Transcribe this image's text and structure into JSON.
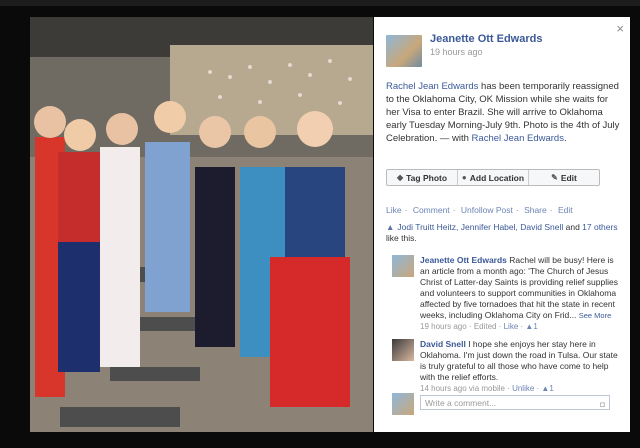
{
  "post": {
    "author": "Jeanette Ott Edwards",
    "time": "19 hours ago",
    "caption_link": "Rachel Jean Edwards",
    "caption_text": " has been temporarily reassigned to the Oklahoma City, OK Mission while she waits for her Visa to enter Brazil. She will arrive to Oklahoma early Tuesday Morning-July 9th. Photo is the 4th of July Celebration. — with ",
    "with_link": "Rachel Jean Edwards",
    "with_end": "."
  },
  "buttons": {
    "tag": "Tag Photo",
    "location": "Add Location",
    "edit": "Edit"
  },
  "actions": {
    "like": "Like",
    "sep": "·",
    "comment": "Comment",
    "unfollow": "Unfollow Post",
    "share": "Share",
    "edit": "Edit"
  },
  "likes": {
    "names": "Jodi Truitt Heitz, Jennifer Habel, David Snell",
    "and": " and ",
    "others": "17 others",
    "end": " like this."
  },
  "comments": [
    {
      "name": "Jeanette Ott Edwards",
      "text": " Rachel will be busy! Here is an article from a month ago: 'The Church of Jesus Christ of Latter-day Saints is providing relief supplies and volunteers to support communities in Oklahoma affected by five tornadoes that hit the state in recent weeks, including Oklahoma City on Frid...",
      "see_more": "See More",
      "time": "19 hours ago",
      "edited": "Edited",
      "like": "Like",
      "count": "1"
    },
    {
      "name": "David Snell",
      "text": " I hope she enjoys her stay here in Oklahoma. I'm just down the road in Tulsa. Our state is truly grateful to all those who have come to help with the relief efforts.",
      "time": "14 hours ago via mobile",
      "like": "Unlike",
      "count": "1"
    }
  ],
  "composer": {
    "placeholder": "Write a comment..."
  },
  "icons": {
    "close": "×",
    "thumb": "👍",
    "camera": "📷"
  }
}
